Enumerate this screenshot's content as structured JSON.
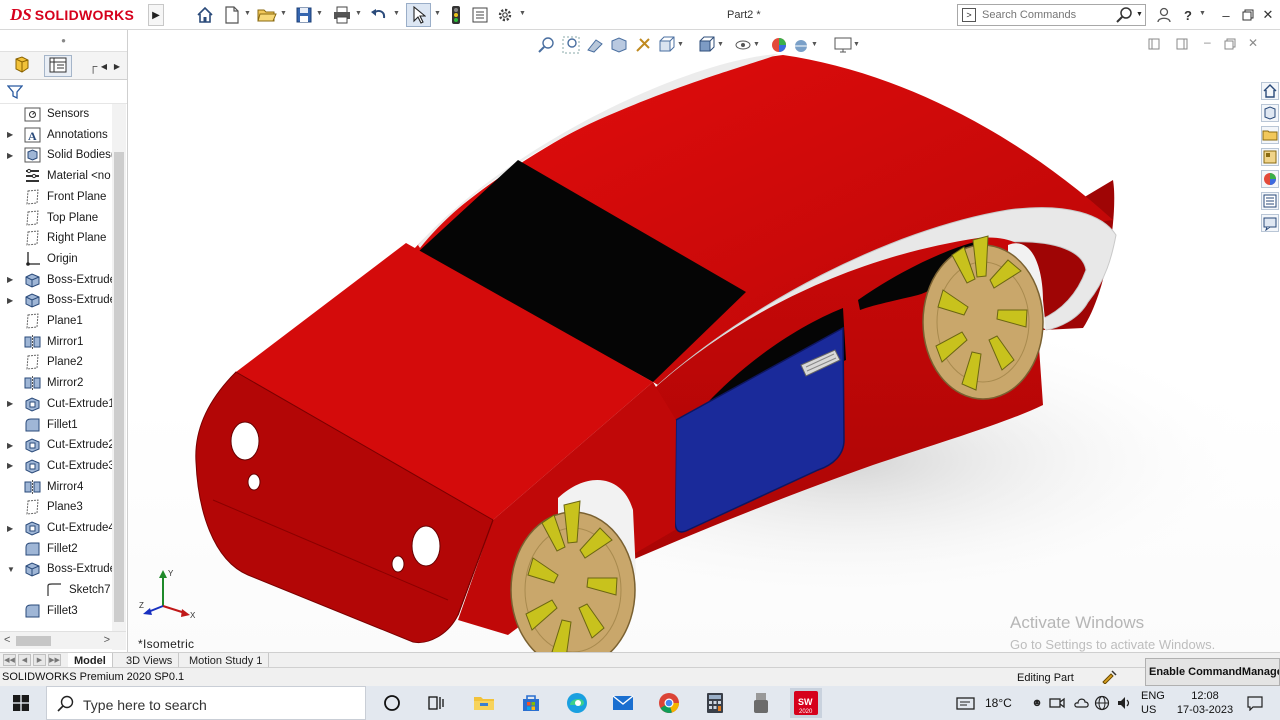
{
  "app": {
    "brand_ds": "DS",
    "brand_name": "SOLIDWORKS",
    "document_title": "Part2 *"
  },
  "search": {
    "placeholder": "Search Commands"
  },
  "feature_tree": [
    {
      "label": "Sensors",
      "icon": "sensor-icon",
      "expandable": false
    },
    {
      "label": "Annotations",
      "icon": "annotations-icon",
      "expandable": true
    },
    {
      "label": "Solid Bodies(",
      "icon": "solid-bodies-icon",
      "expandable": true
    },
    {
      "label": "Material <no",
      "icon": "material-icon",
      "expandable": false
    },
    {
      "label": "Front Plane",
      "icon": "plane-icon",
      "expandable": false
    },
    {
      "label": "Top Plane",
      "icon": "plane-icon",
      "expandable": false
    },
    {
      "label": "Right Plane",
      "icon": "plane-icon",
      "expandable": false
    },
    {
      "label": "Origin",
      "icon": "origin-icon",
      "expandable": false
    },
    {
      "label": "Boss-Extrude",
      "icon": "boss-extrude-icon",
      "expandable": true
    },
    {
      "label": "Boss-Extrude",
      "icon": "boss-extrude-icon",
      "expandable": true
    },
    {
      "label": "Plane1",
      "icon": "plane-icon",
      "expandable": false
    },
    {
      "label": "Mirror1",
      "icon": "mirror-icon",
      "expandable": false
    },
    {
      "label": "Plane2",
      "icon": "plane-icon",
      "expandable": false
    },
    {
      "label": "Mirror2",
      "icon": "mirror-icon",
      "expandable": false
    },
    {
      "label": "Cut-Extrude1",
      "icon": "cut-extrude-icon",
      "expandable": true
    },
    {
      "label": "Fillet1",
      "icon": "fillet-icon",
      "expandable": false
    },
    {
      "label": "Cut-Extrude2",
      "icon": "cut-extrude-icon",
      "expandable": true
    },
    {
      "label": "Cut-Extrude3",
      "icon": "cut-extrude-icon",
      "expandable": true
    },
    {
      "label": "Mirror4",
      "icon": "mirror-icon",
      "expandable": false
    },
    {
      "label": "Plane3",
      "icon": "plane-icon",
      "expandable": false
    },
    {
      "label": "Cut-Extrude4",
      "icon": "cut-extrude-icon",
      "expandable": true
    },
    {
      "label": "Fillet2",
      "icon": "fillet-icon",
      "expandable": false
    },
    {
      "label": "Boss-Extrude",
      "icon": "boss-extrude-icon",
      "expandable": true,
      "expanded": true
    },
    {
      "label": "Sketch7",
      "icon": "sketch-icon",
      "expandable": false,
      "child": true
    },
    {
      "label": "Fillet3",
      "icon": "fillet-icon",
      "expandable": false
    }
  ],
  "viewport": {
    "view_orientation": "*Isometric",
    "watermark_title": "Activate Windows",
    "watermark_subtitle": "Go to Settings to activate Windows.",
    "triad_axes": [
      "Y",
      "X",
      "Z"
    ],
    "colors": {
      "body_red": "#c90b0b",
      "roof_silver": "#e9e9e9",
      "glass_black": "#050505",
      "door_blue": "#1a2a9a",
      "wheel_tan": "#c9a76b",
      "spoke_yellow": "#c8c21d"
    }
  },
  "bottom_tabs": [
    {
      "label": "Model",
      "active": true
    },
    {
      "label": "3D Views",
      "active": false
    },
    {
      "label": "Motion Study 1",
      "active": false
    }
  ],
  "status": {
    "version": "SOLIDWORKS Premium 2020 SP0.1",
    "mode": "Editing Part",
    "command_manager": "Enable CommandManager"
  },
  "taskbar": {
    "search_placeholder": "Type here to search",
    "temperature": "18°C",
    "lang_line1": "ENG",
    "lang_line2": "US",
    "time": "12:08",
    "date": "17-03-2023",
    "sw_badge": "2020"
  }
}
